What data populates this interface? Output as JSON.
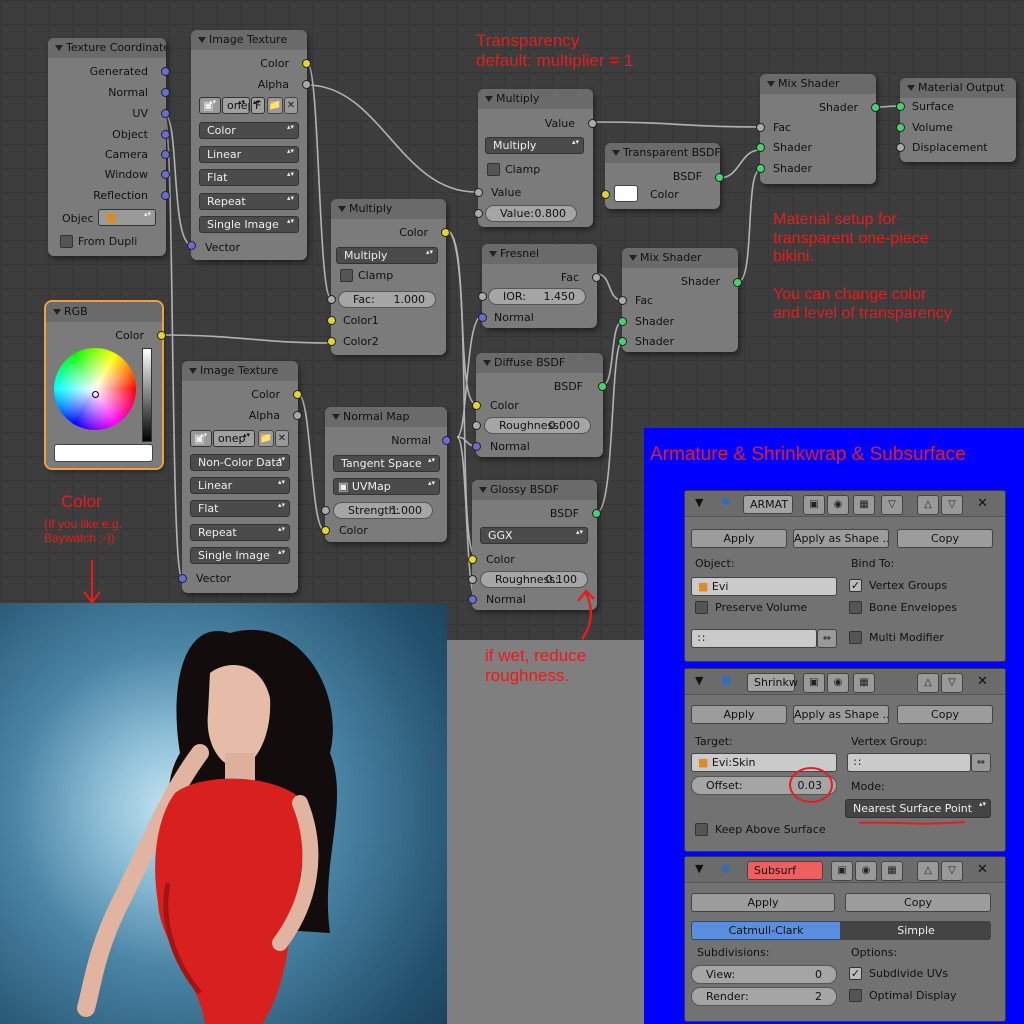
{
  "nodes": {
    "texcoord": {
      "title": "Texture Coordinate",
      "outputs": [
        "Generated",
        "Normal",
        "UV",
        "Object",
        "Camera",
        "Window",
        "Reflection"
      ],
      "objec_label": "Objec",
      "from_dupli": "From Dupli"
    },
    "imgtex1": {
      "title": "Image Texture",
      "out_color": "Color",
      "out_alpha": "Alpha",
      "image_name": "onep",
      "image_flag": "F",
      "color_mode": "Color",
      "interp": "Linear",
      "projection": "Flat",
      "extension": "Repeat",
      "source": "Single Image",
      "in_vector": "Vector"
    },
    "multiply_top": {
      "title": "Multiply",
      "out_value": "Value",
      "op": "Multiply",
      "clamp": "Clamp",
      "in_value": "Value",
      "value_label": "Value:",
      "value": "0.800"
    },
    "transparent": {
      "title": "Transparent BSDF",
      "out": "BSDF",
      "in_color": "Color"
    },
    "mix1": {
      "title": "Mix Shader",
      "out": "Shader",
      "in": [
        "Fac",
        "Shader",
        "Shader"
      ]
    },
    "output": {
      "title": "Material Output",
      "in": [
        "Surface",
        "Volume",
        "Displacement"
      ]
    },
    "multiply2": {
      "title": "Multiply",
      "out": "Color",
      "op": "Multiply",
      "clamp": "Clamp",
      "fac_label": "Fac:",
      "fac": "1.000",
      "in": [
        "Color1",
        "Color2"
      ]
    },
    "fresnel": {
      "title": "Fresnel",
      "out": "Fac",
      "ior_label": "IOR:",
      "ior": "1.450",
      "in_normal": "Normal"
    },
    "mix2": {
      "title": "Mix Shader",
      "out": "Shader",
      "in": [
        "Fac",
        "Shader",
        "Shader"
      ]
    },
    "rgb": {
      "title": "RGB",
      "out": "Color"
    },
    "imgtex2": {
      "title": "Image Texture",
      "out_color": "Color",
      "out_alpha": "Alpha",
      "image_name": "onep",
      "color_mode": "Non-Color Data",
      "interp": "Linear",
      "projection": "Flat",
      "extension": "Repeat",
      "source": "Single Image",
      "in_vector": "Vector"
    },
    "normalmap": {
      "title": "Normal Map",
      "out": "Normal",
      "space": "Tangent Space",
      "uvmap": "UVMap",
      "strength_label": "Strength:",
      "strength": "1.000",
      "in_color": "Color"
    },
    "diffuse": {
      "title": "Diffuse BSDF",
      "out": "BSDF",
      "in_color": "Color",
      "rough_label": "Roughness:",
      "rough": "0.000",
      "in_normal": "Normal"
    },
    "glossy": {
      "title": "Glossy BSDF",
      "out": "BSDF",
      "dist": "GGX",
      "in_color": "Color",
      "rough_label": "Roughness:",
      "rough": "0.100",
      "in_normal": "Normal"
    }
  },
  "annotations": {
    "transparency": "Transparency\ndefault: multiplier = 1",
    "material": "Material setup for\ntransparent one-piece\nbikini.\n\nYou can change color\nand level of transparency",
    "color_title": "Color",
    "color_sub": "(If you like e.g.\nBaywatch ;-))",
    "wet": "if wet, reduce\nroughness.",
    "blue_title": "Armature & Shrinkwrap & Subsurface"
  },
  "armature": {
    "name": "ARMAT",
    "apply": "Apply",
    "apply_shape": "Apply as Shape ...",
    "copy": "Copy",
    "object_label": "Object:",
    "object": "Evi",
    "bind_label": "Bind To:",
    "preserve": "Preserve Volume",
    "vertex_groups": "Vertex Groups",
    "bone_env": "Bone Envelopes",
    "multi": "Multi Modifier"
  },
  "shrinkwrap": {
    "name": "Shrinkw",
    "apply": "Apply",
    "apply_shape": "Apply as Shape ...",
    "copy": "Copy",
    "target_label": "Target:",
    "target": "Evi:Skin",
    "vgroup_label": "Vertex Group:",
    "offset_label": "Offset:",
    "offset": "0.03",
    "mode_label": "Mode:",
    "mode": "Nearest Surface Point",
    "keep_above": "Keep Above Surface"
  },
  "subsurf": {
    "name": "Subsurf",
    "apply": "Apply",
    "copy": "Copy",
    "tab_catmull": "Catmull-Clark",
    "tab_simple": "Simple",
    "subdiv_label": "Subdivisions:",
    "view_label": "View:",
    "view": "0",
    "render_label": "Render:",
    "render": "2",
    "options_label": "Options:",
    "subdivide_uvs": "Subdivide UVs",
    "optimal": "Optimal Display"
  },
  "colors": {
    "accent_red": "#e81c1c",
    "panel_blue": "#0000ff",
    "swimsuit": "#d8201e"
  }
}
